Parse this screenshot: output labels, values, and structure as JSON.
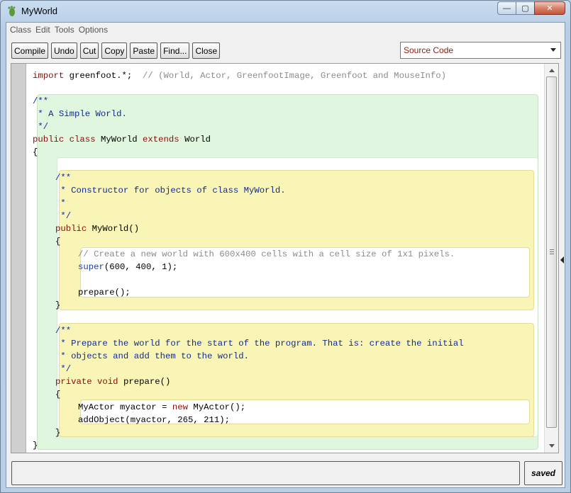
{
  "window": {
    "title": "MyWorld",
    "controls": {
      "minimize": "—",
      "maximize": "▢",
      "close": "✕"
    }
  },
  "menubar": {
    "items": [
      "Class",
      "Edit",
      "Tools",
      "Options"
    ]
  },
  "toolbar": {
    "buttons": [
      "Compile",
      "Undo",
      "Cut",
      "Copy",
      "Paste",
      "Find...",
      "Close"
    ]
  },
  "view_select": {
    "selected": "Source Code"
  },
  "code": {
    "import_kw": "import",
    "import_pkg": " greenfoot.*;",
    "import_comment": "  // (World, Actor, GreenfootImage, Greenfoot and MouseInfo)",
    "class_doc_open": "/**",
    "class_doc_line": " * A Simple World.",
    "class_doc_close": " */",
    "class_decl_public": "public",
    "class_decl_class": "class",
    "class_decl_name": "MyWorld",
    "class_decl_extends": "extends",
    "class_decl_super": "World",
    "brace_open": "{",
    "brace_close": "}",
    "ctor_doc_open": "/**",
    "ctor_doc_line1": " * Constructor for objects of class MyWorld.",
    "ctor_doc_line2": " *",
    "ctor_doc_close": " */",
    "ctor_public": "public",
    "ctor_sig": " MyWorld()",
    "ctor_comment": "// Create a new world with 600x400 cells with a cell size of 1x1 pixels.",
    "ctor_super_kw": "super",
    "ctor_super_args": "(600, 400, 1);",
    "ctor_prepare_call": "prepare();",
    "prep_doc_open": "/**",
    "prep_doc_line1": " * Prepare the world for the start of the program. That is: create the initial",
    "prep_doc_line2": " * objects and add them to the world.",
    "prep_doc_close": " */",
    "prep_private": "private",
    "prep_void": "void",
    "prep_sig": " prepare()",
    "prep_line1_a": "MyActor myactor = ",
    "prep_line1_new": "new",
    "prep_line1_b": " MyActor();",
    "prep_line2": "addObject(myactor, 265, 211);"
  },
  "status": {
    "message": "",
    "saved_label": "saved"
  },
  "icons": [
    "greenfoot-icon",
    "chevron-down-icon",
    "scroll-up-icon",
    "scroll-down-icon",
    "collapse-arrow-icon"
  ]
}
